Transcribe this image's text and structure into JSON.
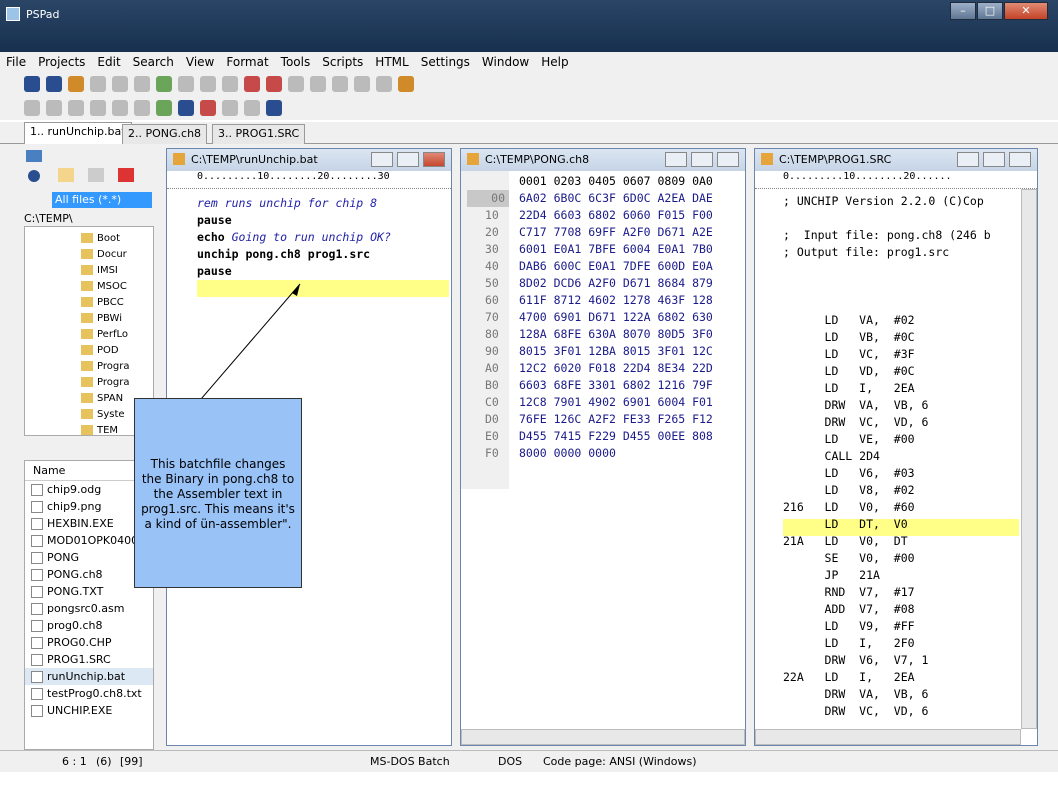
{
  "window": {
    "title": "PSPad"
  },
  "menu": [
    "File",
    "Projects",
    "Edit",
    "Search",
    "View",
    "Format",
    "Tools",
    "Scripts",
    "HTML",
    "Settings",
    "Window",
    "Help"
  ],
  "tabs": [
    "1.. runUnchip.bat",
    "2.. PONG.ch8",
    "3.. PROG1.SRC"
  ],
  "left": {
    "filter": "All files (*.*)",
    "path": "C:\\TEMP\\",
    "tree": [
      "Boot",
      "Docur",
      "IMSI",
      "MSOC",
      "PBCC",
      "PBWi",
      "PerfLo",
      "POD",
      "Progra",
      "Progra",
      "SPAN",
      "Syste",
      "TEM"
    ],
    "files_header": "Name",
    "files": [
      "chip9.odg",
      "chip9.png",
      "HEXBIN.EXE",
      "MOD01OPK0400",
      "PONG",
      "PONG.ch8",
      "PONG.TXT",
      "pongsrc0.asm",
      "prog0.ch8",
      "PROG0.CHP",
      "PROG1.SRC",
      "runUnchip.bat",
      "testProg0.ch8.txt",
      "UNCHIP.EXE"
    ]
  },
  "ed1": {
    "title": "C:\\TEMP\\runUnchip.bat",
    "ruler": "0.........10........20........30",
    "lines": [
      {
        "t": "rem runs unchip for chip 8"
      },
      {
        "t": "pause"
      },
      {
        "t": "echo ",
        "u": "Going to run unchip OK?"
      },
      {
        "t": "unchip pong.ch8 prog1.src"
      },
      {
        "t": "pause"
      }
    ]
  },
  "ed2": {
    "title": "C:\\TEMP\\PONG.ch8",
    "header": "0001 0203 0405 0607 0809 0A0",
    "rows": [
      [
        "00",
        "6A02 6B0C 6C3F 6D0C A2EA DAE"
      ],
      [
        "10",
        "22D4 6603 6802 6060 F015 F00"
      ],
      [
        "20",
        "C717 7708 69FF A2F0 D671 A2E"
      ],
      [
        "30",
        "6001 E0A1 7BFE 6004 E0A1 7B0"
      ],
      [
        "40",
        "DAB6 600C E0A1 7DFE 600D E0A"
      ],
      [
        "50",
        "8D02 DCD6 A2F0 D671 8684 879"
      ],
      [
        "60",
        "611F 8712 4602 1278 463F 128"
      ],
      [
        "70",
        "4700 6901 D671 122A 6802 630"
      ],
      [
        "80",
        "128A 68FE 630A 8070 80D5 3F0"
      ],
      [
        "90",
        "8015 3F01 12BA 8015 3F01 12C"
      ],
      [
        "A0",
        "12C2 6020 F018 22D4 8E34 22D"
      ],
      [
        "B0",
        "6603 68FE 3301 6802 1216 79F"
      ],
      [
        "C0",
        "12C8 7901 4902 6901 6004 F01"
      ],
      [
        "D0",
        "76FE 126C A2F2 FE33 F265 F12"
      ],
      [
        "E0",
        "D455 7415 F229 D455 00EE 808"
      ],
      [
        "F0",
        "8000 0000 0000"
      ]
    ]
  },
  "ed3": {
    "title": "C:\\TEMP\\PROG1.SRC",
    "ruler": "0.........10........20......",
    "lines": [
      "; UNCHIP Version 2.2.0 (C)Cop",
      "",
      ";  Input file: pong.ch8 (246 b",
      "; Output file: prog1.src",
      "",
      "",
      "",
      "      LD   VA,  #02",
      "      LD   VB,  #0C",
      "      LD   VC,  #3F",
      "      LD   VD,  #0C",
      "      LD   I,   2EA",
      "      DRW  VA,  VB, 6",
      "      DRW  VC,  VD, 6",
      "      LD   VE,  #00",
      "      CALL 2D4",
      "      LD   V6,  #03",
      "      LD   V8,  #02",
      "216   LD   V0,  #60",
      "      LD   DT,  V0",
      "21A   LD   V0,  DT",
      "      SE   V0,  #00",
      "      JP   21A",
      "      RND  V7,  #17",
      "      ADD  V7,  #08",
      "      LD   V9,  #FF",
      "      LD   I,   2F0",
      "      DRW  V6,  V7, 1",
      "22A   LD   I,   2EA",
      "      DRW  VA,  VB, 6",
      "      DRW  VC,  VD, 6"
    ]
  },
  "callout": "This batchfile changes the Binary in pong.ch8 to the Assembler text in prog1.src. This means it's a kind of ün-assembler\".",
  "status": {
    "pos": "6 : 1",
    "sel": "(6)",
    "chars": "[99]",
    "type": "MS-DOS Batch",
    "eol": "DOS",
    "codepage": "Code page: ANSI (Windows)"
  }
}
